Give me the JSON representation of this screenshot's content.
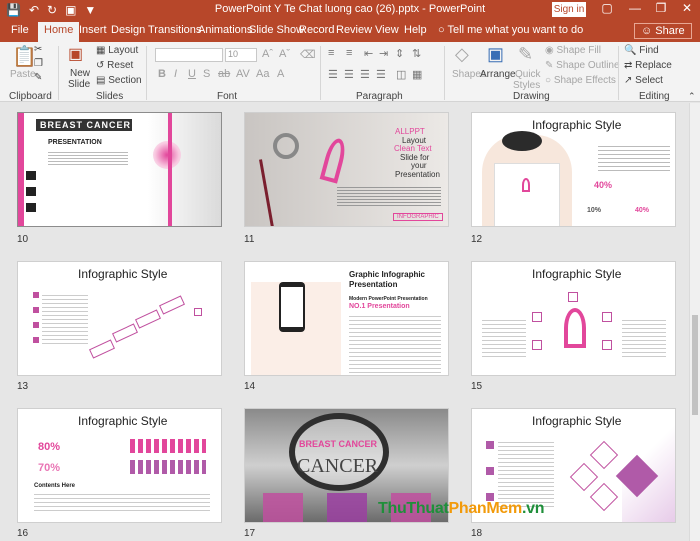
{
  "window": {
    "title": "PowerPoint Y Te Chat luong cao (26).pptx  -  PowerPoint",
    "signin": "Sign in"
  },
  "tabs": [
    "File",
    "Home",
    "Insert",
    "Design",
    "Transitions",
    "Animations",
    "Slide Show",
    "Record",
    "Review",
    "View",
    "Help"
  ],
  "active_tab": "Home",
  "tellme": "Tell me what you want to do",
  "share": "Share",
  "ribbon": {
    "paste": "Paste",
    "clipboard": "Clipboard",
    "new_slide_1": "New",
    "new_slide_2": "Slide",
    "layout": "Layout",
    "reset": "Reset",
    "section": "Section",
    "slides": "Slides",
    "font_size": "10",
    "font": "Font",
    "paragraph": "Paragraph",
    "shapes": "Shapes",
    "arrange": "Arrange",
    "quick_1": "Quick",
    "quick_2": "Styles",
    "shape_fill": "Shape Fill",
    "shape_outline": "Shape Outline",
    "shape_effects": "Shape Effects",
    "drawing": "Drawing",
    "find": "Find",
    "replace": "Replace",
    "select": "Select",
    "editing": "Editing"
  },
  "slides": [
    {
      "num": "10",
      "title": "BREAST CANCER",
      "subtitle": "PRESENTATION"
    },
    {
      "num": "11",
      "line1": "ALLPPT",
      "line2": "Layout",
      "line3": "Clean Text",
      "line4": "Slide for",
      "line5": "your",
      "line6": "Presentation",
      "tag": "INFOGRAPHIC"
    },
    {
      "num": "12",
      "title": "Infographic Style",
      "p1": "40%",
      "p2": "10%",
      "p3": "40%"
    },
    {
      "num": "13",
      "title": "Infographic Style"
    },
    {
      "num": "14",
      "title1": "Graphic Infographic",
      "title2": "Presentation",
      "sub": "Modern PowerPoint Presentation",
      "no1": "NO.1 Presentation"
    },
    {
      "num": "15",
      "title": "Infographic Style"
    },
    {
      "num": "16",
      "title": "Infographic Style",
      "p1": "80%",
      "p2": "70%",
      "contents": "Contents Here"
    },
    {
      "num": "17",
      "title": "BREAST CANCER",
      "word": "CANCER"
    },
    {
      "num": "18",
      "title": "Infographic Style"
    }
  ],
  "watermark": {
    "a": "ThuThuat",
    "b": "PhanMem",
    "c": ".vn"
  },
  "colors": {
    "accent": "#b7472a",
    "pink": "#e2479b"
  }
}
